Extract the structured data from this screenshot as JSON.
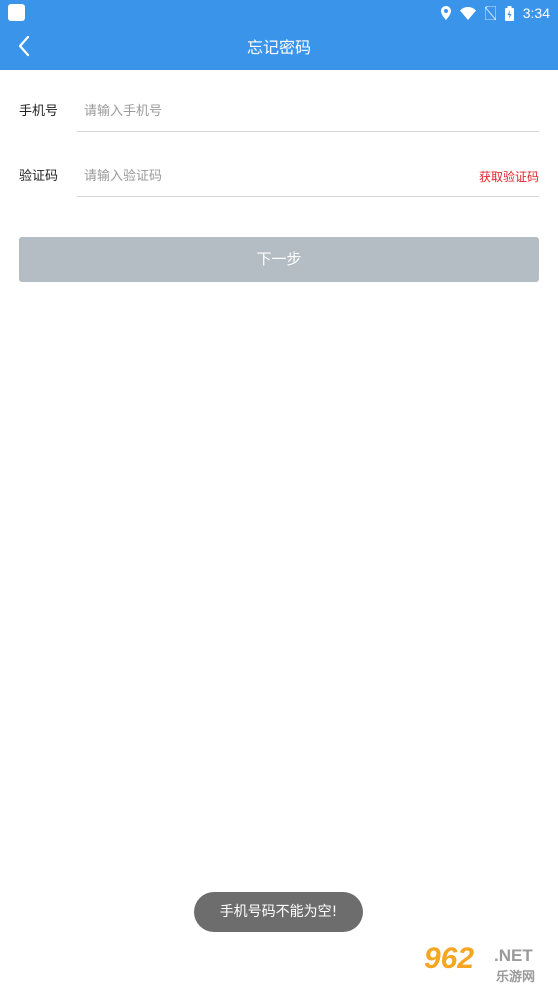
{
  "status_bar": {
    "time": "3:34",
    "icons": [
      "location-icon",
      "wifi-icon",
      "no-sim-icon",
      "battery-icon"
    ]
  },
  "header": {
    "title": "忘记密码",
    "back_icon": "chevron-left-icon"
  },
  "form": {
    "phone": {
      "label": "手机号",
      "placeholder": "请输入手机号",
      "value": ""
    },
    "code": {
      "label": "验证码",
      "placeholder": "请输入验证码",
      "value": "",
      "get_code_label": "获取验证码"
    }
  },
  "next_button_label": "下一步",
  "toast": "手机号码不能为空!",
  "watermark": {
    "number": "962",
    "net": ".NET",
    "name": "乐游网"
  },
  "colors": {
    "header": "#3a95ea",
    "accent_red": "#e0252b",
    "button_disabled": "#b4bcc4",
    "toast_bg": "#6d6d6d"
  }
}
